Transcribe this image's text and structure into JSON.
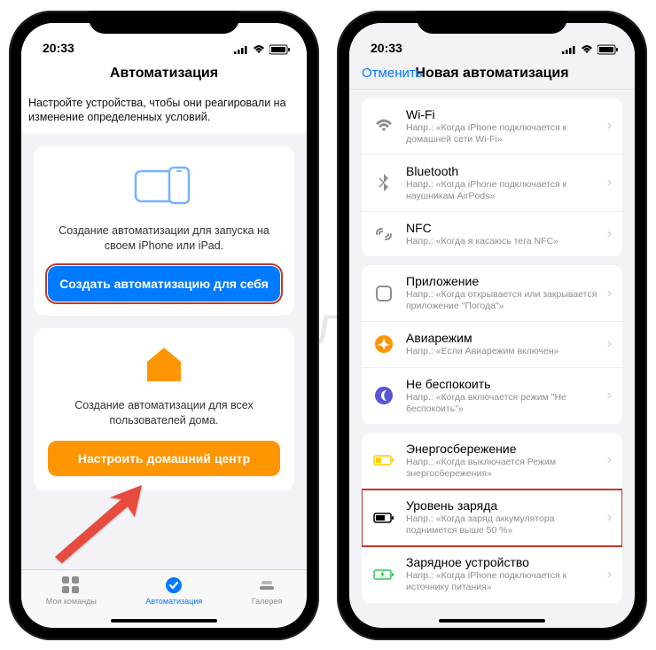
{
  "status": {
    "time": "20:33"
  },
  "left": {
    "title": "Автоматизация",
    "intro": "Настройте устройства, чтобы они реагировали на изменение определенных условий.",
    "card1": {
      "text": "Создание автоматизации для запуска на своем iPhone или iPad.",
      "button": "Создать автоматизацию для себя"
    },
    "card2": {
      "text": "Создание автоматизации для всех пользователей дома.",
      "button": "Настроить домашний центр"
    },
    "tabs": {
      "shortcuts": "Мои команды",
      "automation": "Автоматизация",
      "gallery": "Галерея"
    }
  },
  "right": {
    "cancel": "Отменить",
    "title": "Новая автоматизация",
    "rows": [
      {
        "title": "Wi-Fi",
        "sub": "Напр.: «Когда iPhone подключается к домашней сети Wi-Fi»"
      },
      {
        "title": "Bluetooth",
        "sub": "Напр.: «Когда iPhone подключается к наушникам AirPods»"
      },
      {
        "title": "NFC",
        "sub": "Напр.: «Когда я касаюсь тега NFC»"
      },
      {
        "title": "Приложение",
        "sub": "Напр.: «Когда открывается или закрывается приложение \"Погода\"»"
      },
      {
        "title": "Авиарежим",
        "sub": "Напр.: «Если Авиарежим включен»"
      },
      {
        "title": "Не беспокоить",
        "sub": "Напр.: «Когда включается режим \"Не беспокоить\"»"
      },
      {
        "title": "Энергосбережение",
        "sub": "Напр.: «Когда выключается Режим энергосбережения»"
      },
      {
        "title": "Уровень заряда",
        "sub": "Напр.: «Когда заряд аккумулятора поднимется выше 50 %»"
      },
      {
        "title": "Зарядное устройство",
        "sub": "Напр.: «Когда iPhone подключается к источнику питания»"
      }
    ]
  },
  "watermark": "Я♥лык"
}
